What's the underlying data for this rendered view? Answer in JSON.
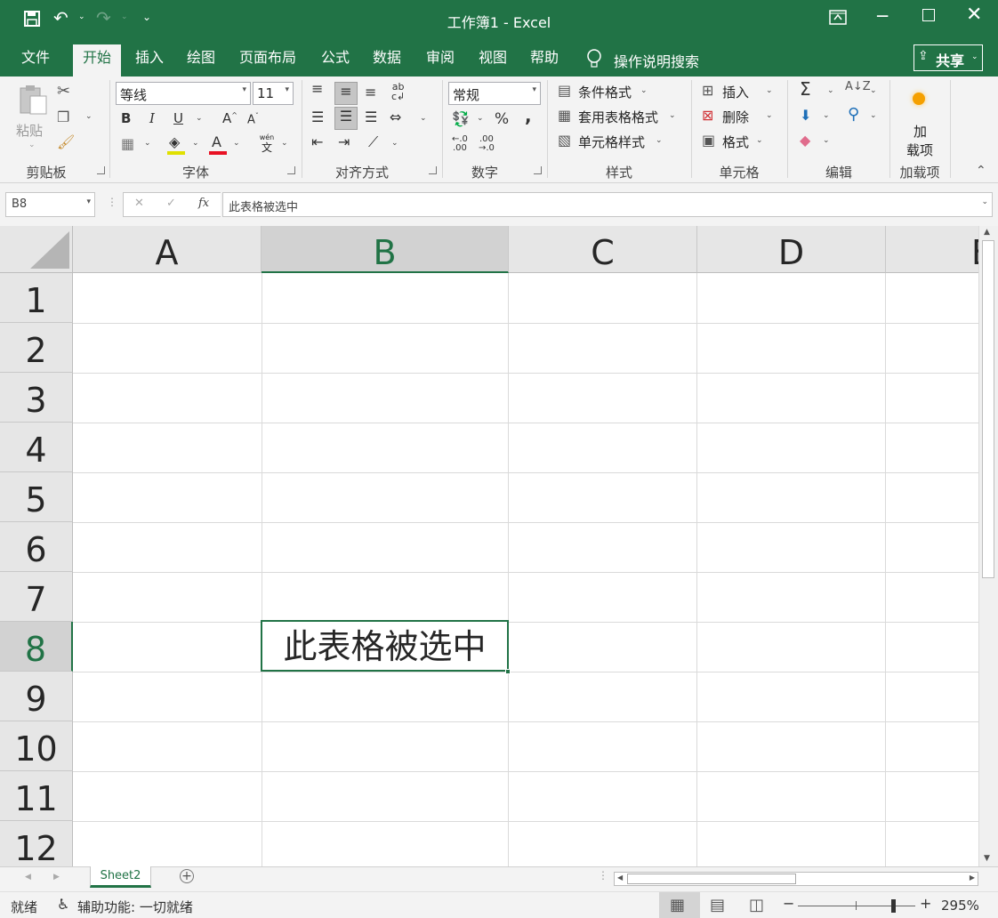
{
  "window": {
    "title": "工作簿1  -  Excel"
  },
  "tabs": [
    {
      "label": "文件"
    },
    {
      "label": "开始"
    },
    {
      "label": "插入"
    },
    {
      "label": "绘图"
    },
    {
      "label": "页面布局"
    },
    {
      "label": "公式"
    },
    {
      "label": "数据"
    },
    {
      "label": "审阅"
    },
    {
      "label": "视图"
    },
    {
      "label": "帮助"
    }
  ],
  "active_tab": "开始",
  "tell_me": "操作说明搜索",
  "share_label": "共享",
  "ribbon": {
    "clipboard": {
      "label": "剪贴板",
      "paste": "粘贴"
    },
    "font": {
      "label": "字体",
      "font_name": "等线",
      "font_size": "11",
      "bold": "B",
      "italic": "I",
      "underline": "U",
      "font_color_letter": "A",
      "phonetic_top": "wén",
      "phonetic_bottom": "文"
    },
    "alignment": {
      "label": "对齐方式"
    },
    "number": {
      "label": "数字",
      "format": "常规",
      "percent": "%",
      "comma": ","
    },
    "styles": {
      "label": "样式",
      "conditional": "条件格式",
      "table": "套用表格格式",
      "cell_styles": "单元格样式"
    },
    "cells": {
      "label": "单元格",
      "insert": "插入",
      "delete": "删除",
      "format": "格式"
    },
    "editing": {
      "label": "编辑",
      "sum": "Σ"
    },
    "addins": {
      "label": "加载项",
      "button_line1": "加",
      "button_line2": "载项"
    }
  },
  "formula_bar": {
    "name_box": "B8",
    "fx": "fx",
    "content": "此表格被选中"
  },
  "sheet": {
    "columns": [
      "A",
      "B",
      "C",
      "D",
      "E"
    ],
    "rows": [
      "1",
      "2",
      "3",
      "4",
      "5",
      "6",
      "7",
      "8",
      "9",
      "10",
      "11",
      "12"
    ],
    "selected_cell": "B8",
    "selected_value": "此表格被选中"
  },
  "sheet_tabs": [
    {
      "label": "Sheet2"
    }
  ],
  "status": {
    "ready": "就绪",
    "accessibility": "辅助功能: 一切就绪",
    "zoom": "295%"
  },
  "colors": {
    "accent": "#217346",
    "font_color_bar": "#e81123"
  }
}
